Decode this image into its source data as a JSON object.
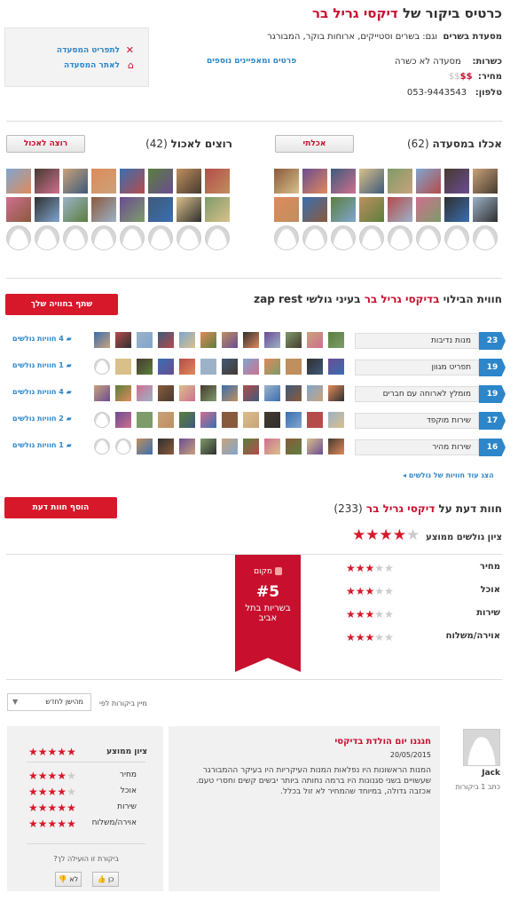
{
  "header": {
    "title_prefix": "כרטיס ביקור של",
    "restaurant_name": "דיקסי גריל בר",
    "category_label": "מסעדת בשרים",
    "also_label": "וגם: בשרים וסטייקים, ארוחות בוקר, המבורגר",
    "kosher_label": "כשרות:",
    "kosher_value": "מסעדה לא כשרה",
    "price_label": "מחיר:",
    "price_value": "$$",
    "price_dim": "$$",
    "phone_label": "טלפון:",
    "phone_value": "053-9443543",
    "details_link": "פרטים ומאפיינים נוספים"
  },
  "side_links": {
    "restaurant_details": "לתפריט המסעדה",
    "restaurant_site": "לאתר המסעדה"
  },
  "ate": {
    "title": "אכלו במסעדה",
    "count": "(62)",
    "button": "אכלתי"
  },
  "want": {
    "title": "רוצים לאכול",
    "count": "(42)",
    "button": "רוצה לאכול"
  },
  "experience": {
    "title_prefix": "חווית הבילוי",
    "restaurant_name": "בדיקסי גריל בר",
    "title_suffix": "בעיני גולשי zap rest",
    "share_button": "שתף בחוויה שלך",
    "rows": [
      {
        "num": "23",
        "label": "מנות נדיבות",
        "count": "4 חוויות גולשים"
      },
      {
        "num": "19",
        "label": "תפריט מגוון",
        "count": "1 חוויות גולשים"
      },
      {
        "num": "19",
        "label": "מומלץ לארוחה עם חברים",
        "count": "4 חוויות גולשים"
      },
      {
        "num": "17",
        "label": "שירות מוקפד",
        "count": "2 חוויות גולשים"
      },
      {
        "num": "16",
        "label": "שירות מהיר",
        "count": "1 חוויות גולשים"
      }
    ],
    "more_link": "הצג עוד חוויות של גולשים"
  },
  "opinions": {
    "title_prefix": "חוות דעת על",
    "restaurant_name": "דיקסי גריל בר",
    "count": "(233)",
    "add_button": "הוסף חוות דעת",
    "avg_label": "ציון גולשים ממוצע",
    "avg_rating": 3.7,
    "ratings": [
      {
        "label": "מחיר",
        "value": 3
      },
      {
        "label": "אוכל",
        "value": 2.5
      },
      {
        "label": "שירות",
        "value": 3
      },
      {
        "label": "אוירה/משלוח",
        "value": 3
      }
    ],
    "ribbon": {
      "place_label": "מקום",
      "rank": "#5",
      "line1": "בשריות בתל",
      "line2": "אביב"
    }
  },
  "sort": {
    "label": "מיין ביקורות לפי",
    "selected": "מהישן לחדש"
  },
  "review": {
    "title": "חגגנו יום הולדת בדיקסי",
    "date": "20/05/2015",
    "body": "המנות הראשונות היו נפלאות המנות העיקריות היו בעיקר ההמבורגר שעשויים בשני סגנונות היו ברמה נחותה ביותר יבשים קשים וחסרי טעם. אכזבה גדולה, במיוחד שהמחיר לא זול בכלל.",
    "author": "Jack",
    "author_meta": "כתב 1 ביקורות",
    "score_label": "ציון ממוצע",
    "score_value": 4.5,
    "ratings": [
      {
        "label": "מחיר",
        "value": 4
      },
      {
        "label": "אוכל",
        "value": 4
      },
      {
        "label": "שירות",
        "value": 5
      },
      {
        "label": "אוירה/משלוח",
        "value": 5
      }
    ],
    "helpful_q": "ביקורת זו הועילה לך?",
    "yes": "כן",
    "no": "לא"
  },
  "colors": {
    "accent": "#c8102e",
    "link": "#2c86c9",
    "button_red": "#d7182a"
  }
}
